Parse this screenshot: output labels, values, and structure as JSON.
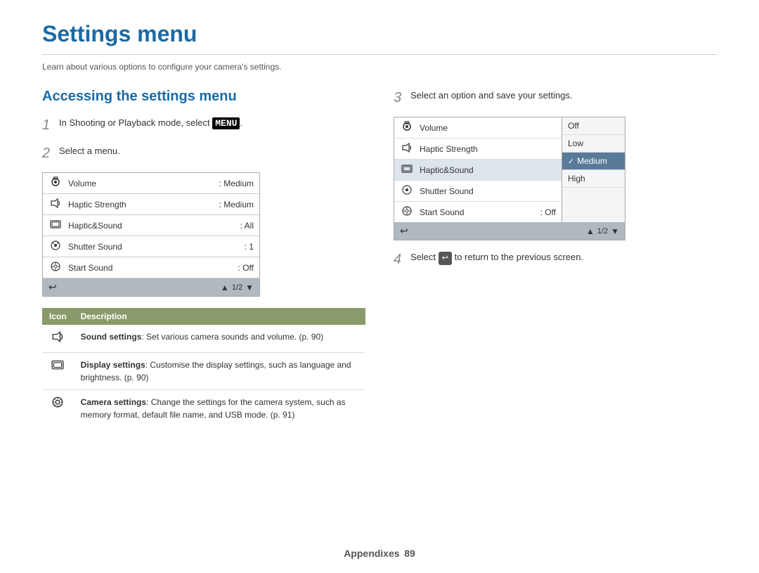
{
  "page": {
    "title": "Settings menu",
    "subtitle": "Learn about various options to configure your camera's settings.",
    "footer_label": "Appendixes",
    "footer_page": "89"
  },
  "left_column": {
    "section_heading": "Accessing the settings menu",
    "step1": {
      "number": "1",
      "text_before": "In Shooting or Playback mode, select ",
      "keyword": "MENU",
      "text_after": "."
    },
    "step2": {
      "number": "2",
      "text": "Select a menu."
    },
    "camera_ui": {
      "rows": [
        {
          "icon": "📷",
          "label": "Volume",
          "value": ": Medium"
        },
        {
          "icon": "🔊",
          "label": "Haptic Strength",
          "value": ": Medium"
        },
        {
          "icon": "📺",
          "label": "Haptic&Sound",
          "value": ": All"
        },
        {
          "icon": "⚙",
          "label": "Shutter Sound",
          "value": ": 1"
        },
        {
          "icon": "⚙",
          "label": "Start Sound",
          "value": ": Off"
        }
      ],
      "footer_page": "1/2"
    },
    "table": {
      "col1_header": "Icon",
      "col2_header": "Description",
      "rows": [
        {
          "icon": "🔊",
          "desc_bold": "Sound settings",
          "desc": ": Set various camera sounds and volume. (p. 90)"
        },
        {
          "icon": "📺",
          "desc_bold": "Display settings",
          "desc": ": Customise the display settings, such as language and brightness. (p. 90)"
        },
        {
          "icon": "⚙",
          "desc_bold": "Camera settings",
          "desc": ": Change the settings for the camera system, such as memory format, default file name, and USB mode. (p. 91)"
        }
      ]
    }
  },
  "right_column": {
    "step3": {
      "number": "3",
      "text": "Select an option and save your settings."
    },
    "camera_ui3": {
      "rows": [
        {
          "icon": "📷",
          "label": "Volume"
        },
        {
          "icon": "🔊",
          "label": "Haptic Strength"
        },
        {
          "icon": "📺",
          "label": "Haptic&Sound"
        },
        {
          "icon": "⚙",
          "label": "Shutter Sound"
        },
        {
          "icon": "⚙",
          "label": "Start Sound"
        }
      ],
      "options": [
        {
          "label": "Off",
          "selected": false
        },
        {
          "label": "Low",
          "selected": false
        },
        {
          "label": "Medium",
          "selected": true
        },
        {
          "label": "High",
          "selected": false
        }
      ],
      "last_row_value": ": Off",
      "footer_page": "1/2"
    },
    "step4": {
      "number": "4",
      "text_before": "Select ",
      "back_symbol": "↩",
      "text_after": " to return to the previous screen."
    }
  }
}
